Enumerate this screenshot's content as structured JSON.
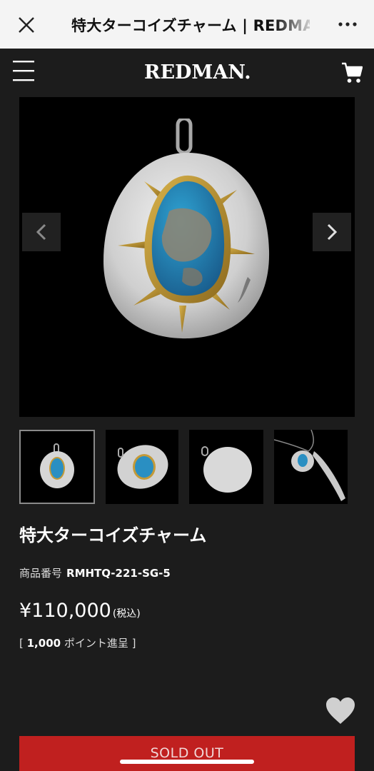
{
  "browser": {
    "title": "特大ターコイズチャーム | REDMAN",
    "close_icon": "close-icon",
    "more_icon": "more-icon"
  },
  "header": {
    "logo": "REDMAN.",
    "menu_icon": "hamburger-menu-icon",
    "cart_icon": "cart-icon"
  },
  "gallery": {
    "prev_icon": "chevron-left-icon",
    "next_icon": "chevron-right-icon",
    "thumbnails": 4,
    "selected": 1
  },
  "product": {
    "name": "特大ターコイズチャーム",
    "sku_label": "商品番号",
    "sku": "RMHTQ-221-SG-5",
    "price": "¥110,000",
    "tax_note": "(税込)",
    "points_prefix": "[ ",
    "points_value": "1,000",
    "points_suffix": " ポイント進呈 ]",
    "favorite_icon": "heart-icon",
    "status_button": "SOLD OUT"
  },
  "colors": {
    "background": "#1c1c1c",
    "soldout": "#c0201f",
    "topbar": "#f4f4f4"
  }
}
